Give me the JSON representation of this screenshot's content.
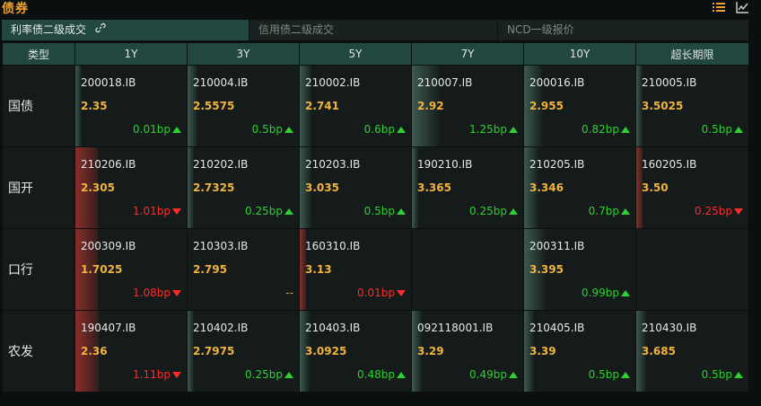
{
  "title": "债券",
  "toolbar": {
    "list_icon": "list-icon",
    "chart_icon": "line-chart-icon"
  },
  "tabs": [
    {
      "label": "利率债二级成交",
      "active": true,
      "icon": "link-icon"
    },
    {
      "label": "信用债二级成交",
      "active": false
    },
    {
      "label": "NCD一级报价",
      "active": false
    }
  ],
  "columns": [
    "类型",
    "1Y",
    "3Y",
    "5Y",
    "7Y",
    "10Y",
    "超长期限"
  ],
  "colors": {
    "up": "#2fd02f",
    "down": "#ff2a2a",
    "yield": "#f1b33c",
    "header": "#22473f"
  },
  "rows": [
    {
      "type": "国债",
      "cells": [
        {
          "code": "200018.IB",
          "yield": "2.35",
          "change": "0.01bp",
          "dir": "up",
          "level": 0
        },
        {
          "code": "210004.IB",
          "yield": "2.5575",
          "change": "0.5bp",
          "dir": "up",
          "level": 0.09
        },
        {
          "code": "210002.IB",
          "yield": "2.741",
          "change": "0.6bp",
          "dir": "up",
          "level": 0.1
        },
        {
          "code": "210007.IB",
          "yield": "2.92",
          "change": "1.25bp",
          "dir": "up",
          "level": 0.24
        },
        {
          "code": "200016.IB",
          "yield": "2.955",
          "change": "0.82bp",
          "dir": "up",
          "level": 0.16
        },
        {
          "code": "210005.IB",
          "yield": "3.5025",
          "change": "0.5bp",
          "dir": "up",
          "level": 0.05
        }
      ]
    },
    {
      "type": "国开",
      "cells": [
        {
          "code": "210206.IB",
          "yield": "2.305",
          "change": "1.01bp",
          "dir": "down",
          "level": 0.2
        },
        {
          "code": "210202.IB",
          "yield": "2.7325",
          "change": "0.25bp",
          "dir": "up",
          "level": 0.05
        },
        {
          "code": "210203.IB",
          "yield": "3.035",
          "change": "0.5bp",
          "dir": "up",
          "level": 0.1
        },
        {
          "code": "190210.IB",
          "yield": "3.365",
          "change": "0.25bp",
          "dir": "up",
          "level": 0.05
        },
        {
          "code": "210205.IB",
          "yield": "3.346",
          "change": "0.7bp",
          "dir": "up",
          "level": 0.13
        },
        {
          "code": "160205.IB",
          "yield": "3.50",
          "change": "0.25bp",
          "dir": "down",
          "level": 0.05
        }
      ]
    },
    {
      "type": "口行",
      "cells": [
        {
          "code": "200309.IB",
          "yield": "1.7025",
          "change": "1.08bp",
          "dir": "down",
          "level": 0.2
        },
        {
          "code": "210303.IB",
          "yield": "2.795",
          "change": "--",
          "dir": "flat",
          "level": 0
        },
        {
          "code": "160310.IB",
          "yield": "3.13",
          "change": "0.01bp",
          "dir": "down",
          "level": 0
        },
        {
          "code": "",
          "yield": "",
          "change": "",
          "dir": "none",
          "level": 0
        },
        {
          "code": "200311.IB",
          "yield": "3.395",
          "change": "0.99bp",
          "dir": "up",
          "level": 0.19
        },
        {
          "code": "",
          "yield": "",
          "change": "",
          "dir": "none",
          "level": 0
        }
      ]
    },
    {
      "type": "农发",
      "cells": [
        {
          "code": "190407.IB",
          "yield": "2.36",
          "change": "1.11bp",
          "dir": "down",
          "level": 0.21
        },
        {
          "code": "210402.IB",
          "yield": "2.7975",
          "change": "0.25bp",
          "dir": "up",
          "level": 0.05
        },
        {
          "code": "210403.IB",
          "yield": "3.0925",
          "change": "0.48bp",
          "dir": "up",
          "level": 0.09
        },
        {
          "code": "092118001.IB",
          "yield": "3.29",
          "change": "0.49bp",
          "dir": "up",
          "level": 0.09
        },
        {
          "code": "210405.IB",
          "yield": "3.39",
          "change": "0.5bp",
          "dir": "up",
          "level": 0.09
        },
        {
          "code": "210430.IB",
          "yield": "3.685",
          "change": "0.5bp",
          "dir": "up",
          "level": 0.09
        }
      ]
    }
  ]
}
